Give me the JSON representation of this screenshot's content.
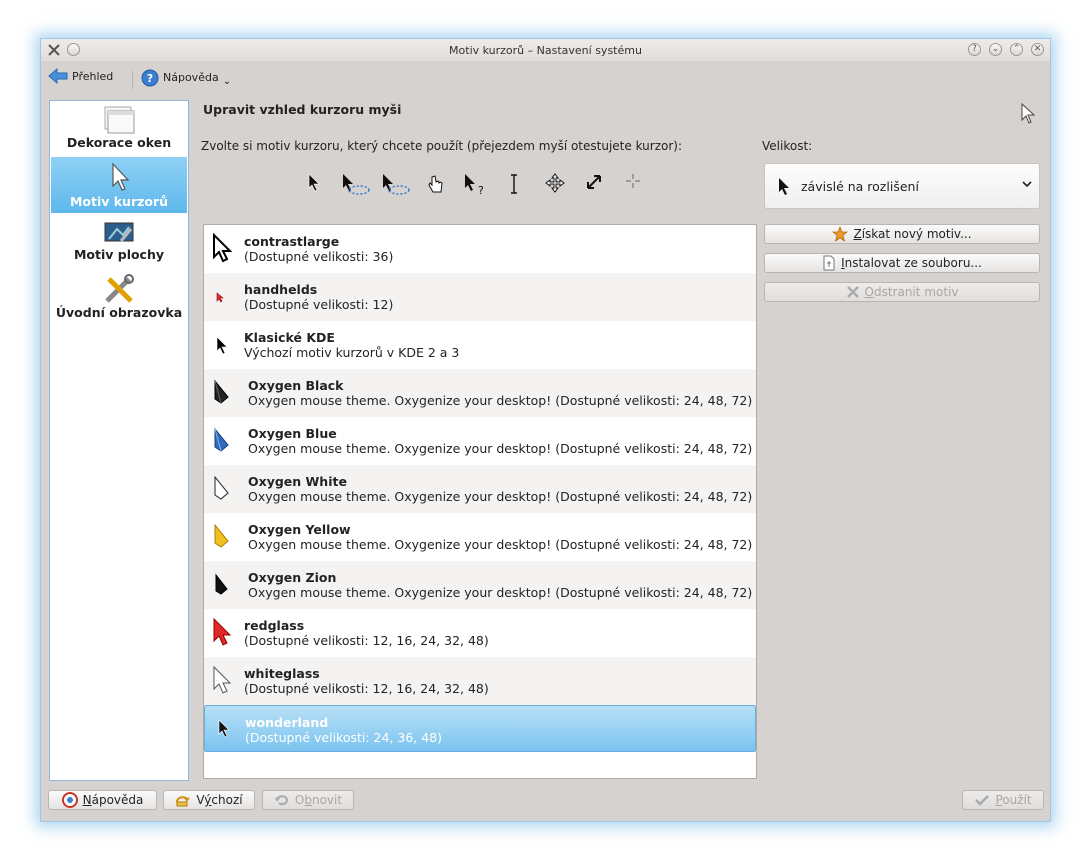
{
  "window": {
    "title": "Motiv kurzorů – Nastavení systému",
    "controls": [
      "?",
      "⌄",
      "⌃",
      "✕"
    ]
  },
  "toolbar": {
    "overview_label": "Přehled",
    "help_label": "Nápověda"
  },
  "sidebar": {
    "items": [
      {
        "label": "Dekorace oken",
        "active": false
      },
      {
        "label": "Motiv kurzorů",
        "active": true
      },
      {
        "label": "Motiv plochy",
        "active": false
      },
      {
        "label": "Úvodní obrazovka",
        "active": false
      }
    ]
  },
  "main": {
    "heading": "Upravit vzhled kurzoru myši",
    "subtitle": "Zvolte si motiv kurzoru, který chcete použít (přejezdem myší otestujete kurzor):",
    "size_label": "Velikost:",
    "size_value": "závislé na rozlišení"
  },
  "themes": [
    {
      "name": "contrastlarge",
      "desc": "(Dostupné velikosti: 36)"
    },
    {
      "name": "handhelds",
      "desc": "(Dostupné velikosti: 12)"
    },
    {
      "name": "Klasické KDE",
      "desc": "Výchozí motiv kurzorů v KDE 2 a 3"
    },
    {
      "name": "Oxygen Black",
      "desc": "Oxygen mouse theme. Oxygenize your desktop! (Dostupné velikosti: 24, 48, 72)"
    },
    {
      "name": "Oxygen Blue",
      "desc": "Oxygen mouse theme. Oxygenize your desktop! (Dostupné velikosti: 24, 48, 72)"
    },
    {
      "name": "Oxygen White",
      "desc": "Oxygen mouse theme. Oxygenize your desktop! (Dostupné velikosti: 24, 48, 72)"
    },
    {
      "name": "Oxygen Yellow",
      "desc": "Oxygen mouse theme. Oxygenize your desktop! (Dostupné velikosti: 24, 48, 72)"
    },
    {
      "name": "Oxygen Zion",
      "desc": "Oxygen mouse theme. Oxygenize your desktop! (Dostupné velikosti: 24, 48, 72)"
    },
    {
      "name": "redglass",
      "desc": "(Dostupné velikosti: 12, 16, 24, 32, 48)"
    },
    {
      "name": "whiteglass",
      "desc": "(Dostupné velikosti: 12, 16, 24, 32, 48)"
    },
    {
      "name": "wonderland",
      "desc": "(Dostupné velikosti: 24, 36, 48)",
      "selected": true
    }
  ],
  "actions": {
    "get_new": {
      "u": "Z",
      "rest": "ískat nový motiv..."
    },
    "install": {
      "u": "I",
      "rest": "nstalovat ze souboru..."
    },
    "remove": {
      "u": "O",
      "rest": "dstranit motiv"
    }
  },
  "bottom": {
    "help": {
      "pre": "",
      "u": "N",
      "rest": "ápověda"
    },
    "defaults": {
      "pre": "V",
      "u": "ý",
      "rest": "chozí"
    },
    "reset": {
      "pre": "O",
      "u": "b",
      "rest": "novit"
    },
    "apply": {
      "pre": "",
      "u": "P",
      "rest": "oužít"
    }
  },
  "colors": {
    "accent": "#5eb8ec",
    "window_bg": "#d6d2d0"
  }
}
